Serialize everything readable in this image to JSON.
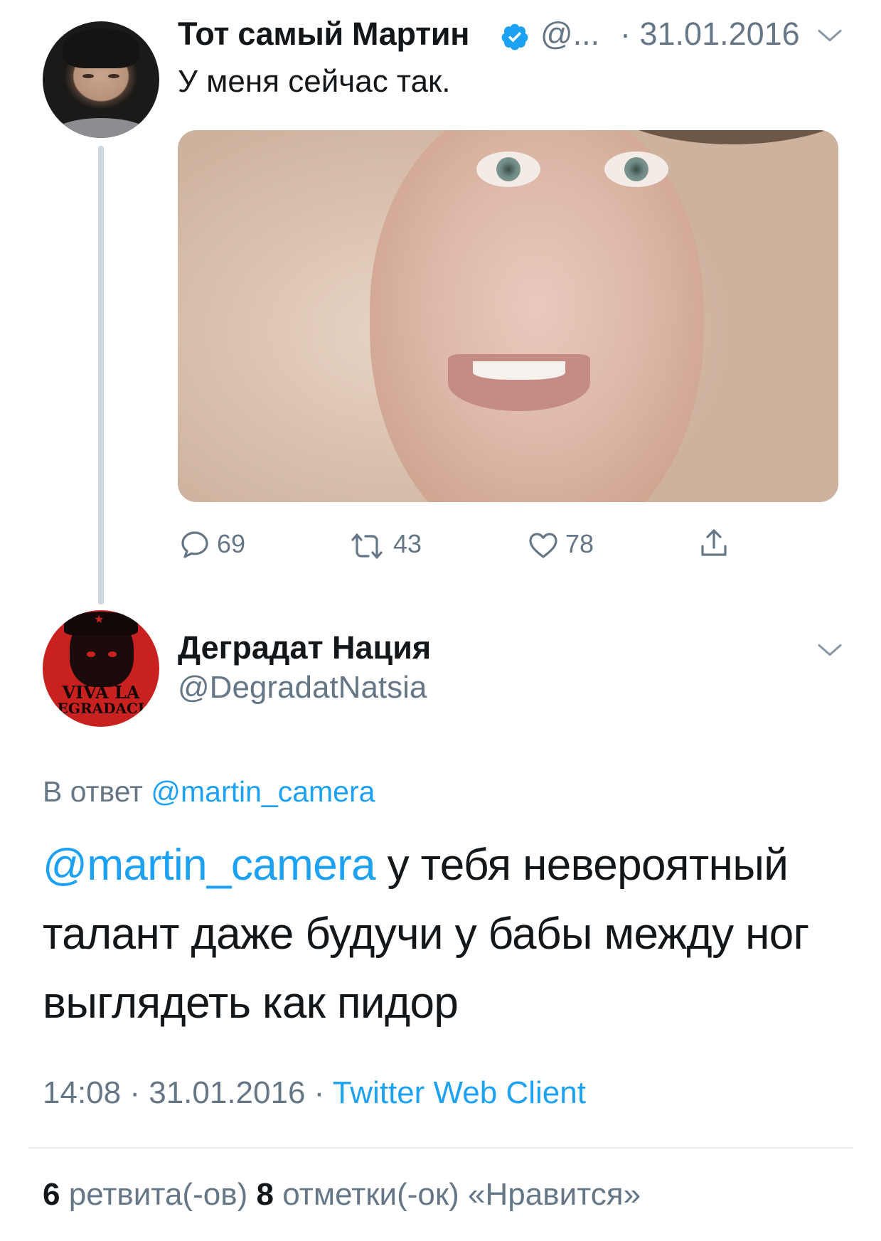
{
  "parent_tweet": {
    "author_name": "Тот самый Мартин",
    "verified": true,
    "handle": "@...",
    "date": "· 31.01.2016",
    "text": "У меня сейчас так.",
    "replies": "69",
    "retweets": "43",
    "likes": "78",
    "avatar_icon": "user-avatar",
    "photo_icon": "tweet-photo"
  },
  "reply_tweet": {
    "author_name": "Деградат Нация",
    "handle": "@DegradatNatsia",
    "avatar_text_line1": "VIVA LA",
    "avatar_text_line2": "DEGRADACIÓ",
    "in_reply_prefix": "В ответ",
    "in_reply_handle": "@martin_camera",
    "mention": "@martin_camera",
    "text": " у тебя невероятный талант даже будучи у бабы между ног выглядеть как пидор",
    "time": "14:08",
    "date": "31.01.2016",
    "source": "Twitter Web Client",
    "separator": " · "
  },
  "stats": {
    "retweets_count": "6",
    "retweets_label": "ретвита(-ов)",
    "likes_count": "8",
    "likes_label": "отметки(-ок) «Нравится»"
  },
  "colors": {
    "link": "#1da1f2",
    "secondary_text": "#657786",
    "primary_text": "#14171a",
    "thread_line": "#ccd6dd",
    "divider": "#e6ecf0"
  }
}
